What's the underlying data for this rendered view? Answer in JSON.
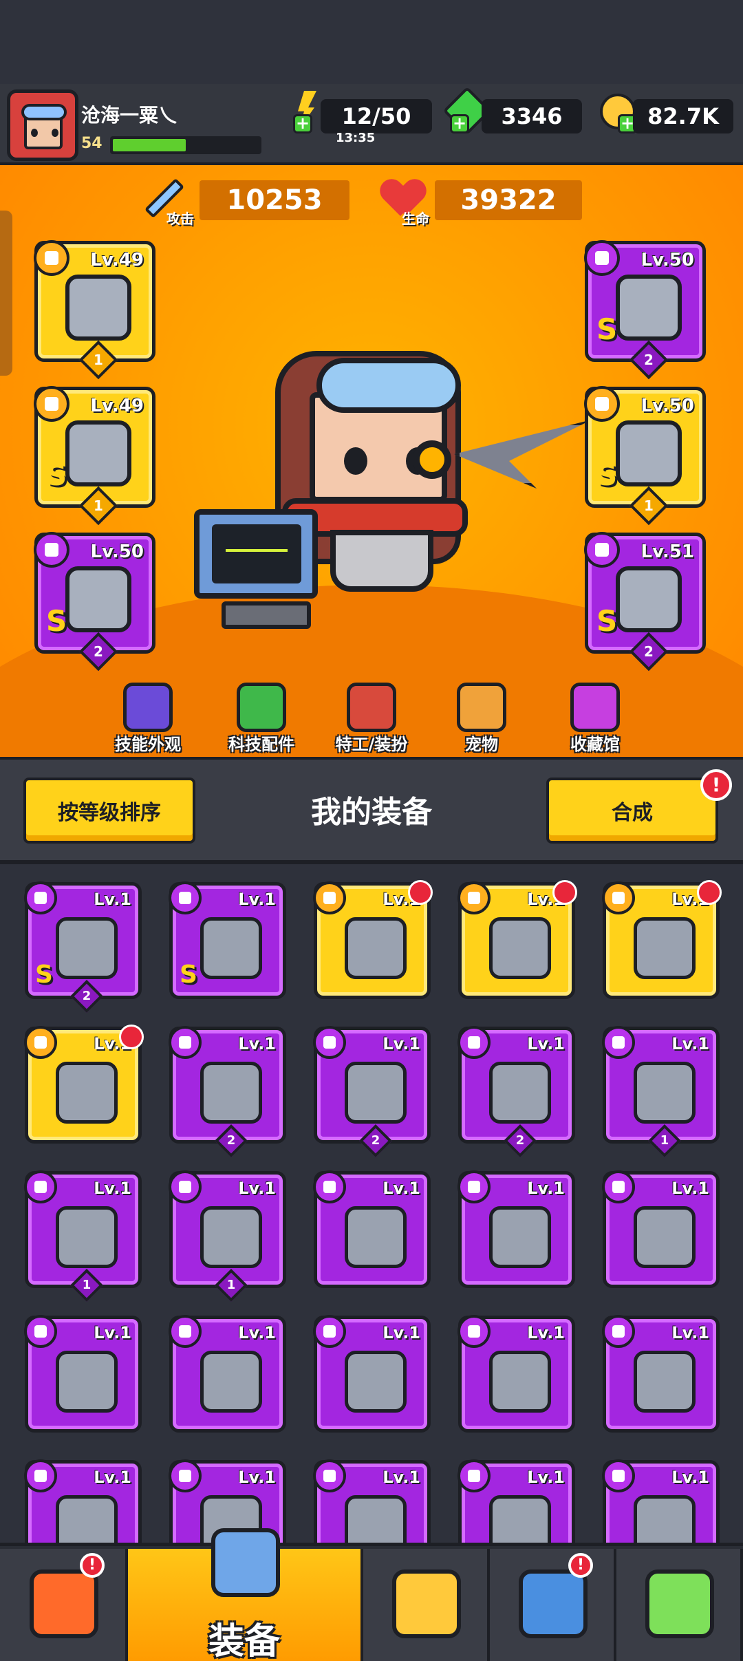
{
  "player": {
    "name": "沧海一粟乀",
    "level": "54",
    "xp_fraction": 0.5
  },
  "resources": {
    "energy": "12/50",
    "energy_timer": "13:35",
    "gems": "3346",
    "coins": "82.7K"
  },
  "stats": {
    "attack_label": "攻击",
    "attack_value": "10253",
    "hp_label": "生命",
    "hp_value": "39322"
  },
  "equipped": {
    "left": [
      {
        "lv": "Lv.49",
        "s": "",
        "stars": "1",
        "color": "yellow",
        "icon": "kunai-icon"
      },
      {
        "lv": "Lv.49",
        "s": "S",
        "stars": "1",
        "color": "yellow",
        "icon": "ring-icon"
      },
      {
        "lv": "Lv.50",
        "s": "S",
        "stars": "2",
        "color": "purple",
        "icon": "gauntlet-icon"
      }
    ],
    "right": [
      {
        "lv": "Lv.50",
        "s": "S",
        "stars": "2",
        "color": "purple",
        "icon": "armor-icon"
      },
      {
        "lv": "Lv.50",
        "s": "S",
        "stars": "1",
        "color": "yellow",
        "icon": "belt-icon"
      },
      {
        "lv": "Lv.51",
        "s": "S",
        "stars": "2",
        "color": "purple",
        "icon": "boots-icon"
      }
    ]
  },
  "menu": [
    {
      "label": "技能外观",
      "icon": "skill-skin-icon",
      "color": "#6b4bd8"
    },
    {
      "label": "科技配件",
      "icon": "tech-part-icon",
      "color": "#3fb84a"
    },
    {
      "label": "特工/装扮",
      "icon": "agent-costume-icon",
      "color": "#d84a3c"
    },
    {
      "label": "宠物",
      "icon": "pet-icon",
      "color": "#f0a23a"
    },
    {
      "label": "收藏馆",
      "icon": "collection-icon",
      "color": "#c63fe0"
    }
  ],
  "equipment_panel": {
    "sort_label": "按等级排序",
    "title": "我的装备",
    "merge_label": "合成",
    "merge_alert": "!"
  },
  "inventory": [
    {
      "lv": "Lv.1",
      "color": "purple",
      "s": "S",
      "stars": "2",
      "new": false,
      "icon": "ring-icon"
    },
    {
      "lv": "Lv.1",
      "color": "purple",
      "s": "S",
      "stars": "",
      "new": false,
      "icon": "dagger-icon"
    },
    {
      "lv": "Lv.1",
      "color": "yellow",
      "s": "",
      "stars": "",
      "new": true,
      "icon": "armor-icon"
    },
    {
      "lv": "Lv.1",
      "color": "yellow",
      "s": "",
      "stars": "",
      "new": true,
      "icon": "armor-icon"
    },
    {
      "lv": "Lv.1",
      "color": "yellow",
      "s": "",
      "stars": "",
      "new": true,
      "icon": "gauntlet-icon"
    },
    {
      "lv": "Lv.1",
      "color": "yellow",
      "s": "",
      "stars": "",
      "new": true,
      "icon": "boots-icon"
    },
    {
      "lv": "Lv.1",
      "color": "purple",
      "s": "",
      "stars": "2",
      "new": false,
      "icon": "sword-icon"
    },
    {
      "lv": "Lv.1",
      "color": "purple",
      "s": "",
      "stars": "2",
      "new": false,
      "icon": "belt-icon"
    },
    {
      "lv": "Lv.1",
      "color": "purple",
      "s": "",
      "stars": "2",
      "new": false,
      "icon": "gauntlet-icon"
    },
    {
      "lv": "Lv.1",
      "color": "purple",
      "s": "",
      "stars": "1",
      "new": false,
      "icon": "sword-icon"
    },
    {
      "lv": "Lv.1",
      "color": "purple",
      "s": "",
      "stars": "1",
      "new": false,
      "icon": "belt-icon"
    },
    {
      "lv": "Lv.1",
      "color": "purple",
      "s": "",
      "stars": "1",
      "new": false,
      "icon": "gauntlet-icon"
    },
    {
      "lv": "Lv.1",
      "color": "purple",
      "s": "",
      "stars": "",
      "new": false,
      "icon": "kunai-icon"
    },
    {
      "lv": "Lv.1",
      "color": "purple",
      "s": "",
      "stars": "",
      "new": false,
      "icon": "armor-icon"
    },
    {
      "lv": "Lv.1",
      "color": "purple",
      "s": "",
      "stars": "",
      "new": false,
      "icon": "armor-icon"
    },
    {
      "lv": "Lv.1",
      "color": "purple",
      "s": "",
      "stars": "",
      "new": false,
      "icon": "armor-icon"
    },
    {
      "lv": "Lv.1",
      "color": "purple",
      "s": "",
      "stars": "",
      "new": false,
      "icon": "necklace-icon"
    },
    {
      "lv": "Lv.1",
      "color": "purple",
      "s": "",
      "stars": "",
      "new": false,
      "icon": "ring-icon"
    },
    {
      "lv": "Lv.1",
      "color": "purple",
      "s": "",
      "stars": "",
      "new": false,
      "icon": "necklace-icon"
    },
    {
      "lv": "Lv.1",
      "color": "purple",
      "s": "",
      "stars": "",
      "new": false,
      "icon": "necklace-icon"
    },
    {
      "lv": "Lv.1",
      "color": "purple",
      "s": "",
      "stars": "",
      "new": false,
      "icon": "gauntlet-icon"
    },
    {
      "lv": "Lv.1",
      "color": "purple",
      "s": "",
      "stars": "",
      "new": false,
      "icon": "boots-icon"
    },
    {
      "lv": "Lv.1",
      "color": "purple",
      "s": "",
      "stars": "",
      "new": false,
      "icon": "boots-icon"
    },
    {
      "lv": "Lv.1",
      "color": "purple",
      "s": "",
      "stars": "",
      "new": false,
      "icon": "boots-icon"
    },
    {
      "lv": "Lv.1",
      "color": "purple",
      "s": "",
      "stars": "",
      "new": false,
      "icon": "boots-icon"
    }
  ],
  "bottom_nav": [
    {
      "label": "",
      "icon": "shop-icon",
      "alert": "!"
    },
    {
      "label": "装备",
      "icon": "equipment-icon",
      "alert": ""
    },
    {
      "label": "",
      "icon": "star-battle-icon",
      "alert": ""
    },
    {
      "label": "",
      "icon": "planet-icon",
      "alert": "!"
    },
    {
      "label": "",
      "icon": "dna-icon",
      "alert": ""
    }
  ],
  "colors": {
    "accent_yellow": "#ffd21a",
    "accent_purple": "#a326e0",
    "hero_bg": "#ff9a00",
    "alert_red": "#e8263a"
  }
}
